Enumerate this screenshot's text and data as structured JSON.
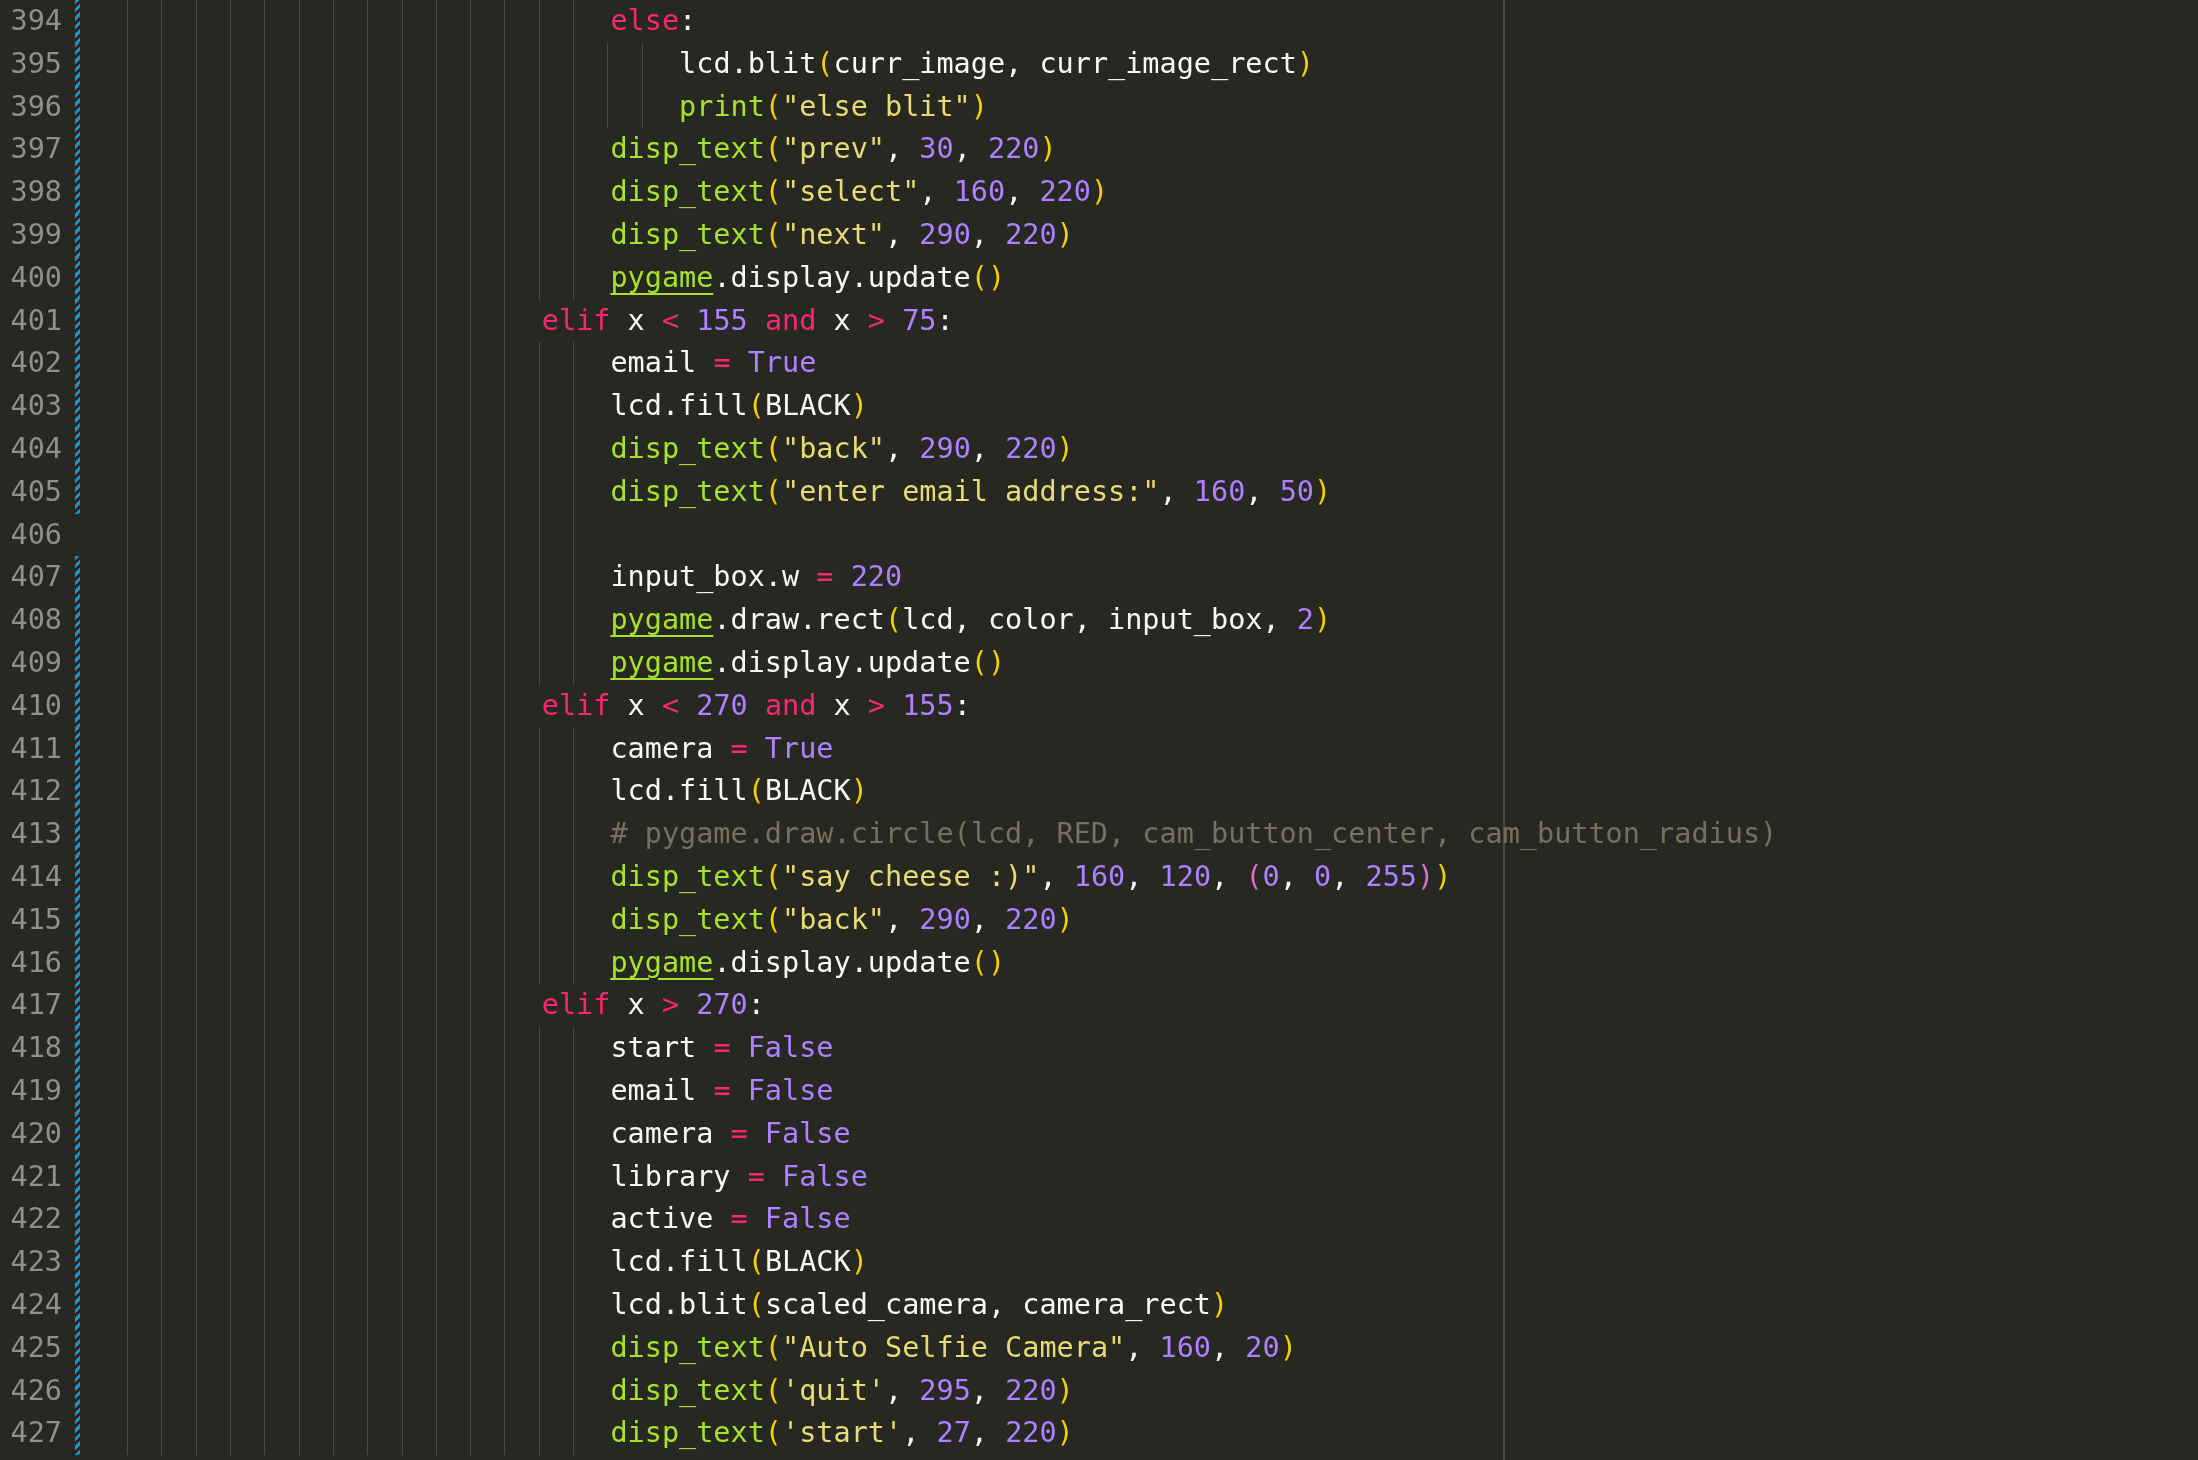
{
  "editor": {
    "lines": [
      {
        "number": "394",
        "changed": true,
        "kind": "statement",
        "tokens": [
          {
            "kind": "keyword",
            "text": "else"
          },
          {
            "kind": "plain",
            "text": ":"
          }
        ]
      },
      {
        "number": "395",
        "changed": true,
        "kind": "inner",
        "tokens": [
          {
            "kind": "plain",
            "text": "lcd.blit"
          },
          {
            "kind": "paren1",
            "text": "("
          },
          {
            "kind": "plain",
            "text": "curr_image, curr_image_rect"
          },
          {
            "kind": "paren1",
            "text": ")"
          }
        ]
      },
      {
        "number": "396",
        "changed": true,
        "kind": "inner",
        "tokens": [
          {
            "kind": "func",
            "text": "print"
          },
          {
            "kind": "paren1",
            "text": "("
          },
          {
            "kind": "string",
            "text": "\"else blit\""
          },
          {
            "kind": "paren1",
            "text": ")"
          }
        ]
      },
      {
        "number": "397",
        "changed": true,
        "kind": "statement",
        "tokens": [
          {
            "kind": "func",
            "text": "disp_text"
          },
          {
            "kind": "paren1",
            "text": "("
          },
          {
            "kind": "string",
            "text": "\"prev\""
          },
          {
            "kind": "plain",
            "text": ","
          },
          {
            "kind": "number",
            "text": " 30"
          },
          {
            "kind": "plain",
            "text": ","
          },
          {
            "kind": "number",
            "text": " 220"
          },
          {
            "kind": "paren1",
            "text": ")"
          }
        ]
      },
      {
        "number": "398",
        "changed": true,
        "kind": "statement",
        "tokens": [
          {
            "kind": "func",
            "text": "disp_text"
          },
          {
            "kind": "paren1",
            "text": "("
          },
          {
            "kind": "string",
            "text": "\"select\""
          },
          {
            "kind": "plain",
            "text": ","
          },
          {
            "kind": "number",
            "text": " 160"
          },
          {
            "kind": "plain",
            "text": ","
          },
          {
            "kind": "number",
            "text": " 220"
          },
          {
            "kind": "paren1",
            "text": ")"
          }
        ]
      },
      {
        "number": "399",
        "changed": true,
        "kind": "statement",
        "tokens": [
          {
            "kind": "func",
            "text": "disp_text"
          },
          {
            "kind": "paren1",
            "text": "("
          },
          {
            "kind": "string",
            "text": "\"next\""
          },
          {
            "kind": "plain",
            "text": ","
          },
          {
            "kind": "number",
            "text": " 290"
          },
          {
            "kind": "plain",
            "text": ","
          },
          {
            "kind": "number",
            "text": " 220"
          },
          {
            "kind": "paren1",
            "text": ")"
          }
        ]
      },
      {
        "number": "400",
        "changed": true,
        "kind": "statement",
        "tokens": [
          {
            "kind": "module",
            "text": "pygame"
          },
          {
            "kind": "plain",
            "text": ".display.update"
          },
          {
            "kind": "paren1",
            "text": "()"
          }
        ]
      },
      {
        "number": "401",
        "changed": true,
        "kind": "header",
        "tokens": [
          {
            "kind": "keyword",
            "text": "elif"
          },
          {
            "kind": "plain",
            "text": " x"
          },
          {
            "kind": "keyword",
            "text": " <"
          },
          {
            "kind": "number",
            "text": " 155"
          },
          {
            "kind": "keyword",
            "text": " and"
          },
          {
            "kind": "plain",
            "text": " x"
          },
          {
            "kind": "keyword",
            "text": " >"
          },
          {
            "kind": "number",
            "text": " 75"
          },
          {
            "kind": "plain",
            "text": ":"
          }
        ]
      },
      {
        "number": "402",
        "changed": true,
        "kind": "statement",
        "tokens": [
          {
            "kind": "plain",
            "text": "email"
          },
          {
            "kind": "keyword",
            "text": " ="
          },
          {
            "kind": "number",
            "text": " True"
          }
        ]
      },
      {
        "number": "403",
        "changed": true,
        "kind": "statement",
        "tokens": [
          {
            "kind": "plain",
            "text": "lcd.fill"
          },
          {
            "kind": "paren1",
            "text": "("
          },
          {
            "kind": "plain",
            "text": "BLACK"
          },
          {
            "kind": "paren1",
            "text": ")"
          }
        ]
      },
      {
        "number": "404",
        "changed": true,
        "kind": "statement",
        "tokens": [
          {
            "kind": "func",
            "text": "disp_text"
          },
          {
            "kind": "paren1",
            "text": "("
          },
          {
            "kind": "string",
            "text": "\"back\""
          },
          {
            "kind": "plain",
            "text": ","
          },
          {
            "kind": "number",
            "text": " 290"
          },
          {
            "kind": "plain",
            "text": ","
          },
          {
            "kind": "number",
            "text": " 220"
          },
          {
            "kind": "paren1",
            "text": ")"
          }
        ]
      },
      {
        "number": "405",
        "changed": true,
        "kind": "statement",
        "tokens": [
          {
            "kind": "func",
            "text": "disp_text"
          },
          {
            "kind": "paren1",
            "text": "("
          },
          {
            "kind": "string",
            "text": "\"enter email address:\""
          },
          {
            "kind": "plain",
            "text": ","
          },
          {
            "kind": "number",
            "text": " 160"
          },
          {
            "kind": "plain",
            "text": ","
          },
          {
            "kind": "number",
            "text": " 50"
          },
          {
            "kind": "paren1",
            "text": ")"
          }
        ]
      },
      {
        "number": "406",
        "changed": false,
        "kind": "blank"
      },
      {
        "number": "407",
        "changed": true,
        "kind": "statement",
        "tokens": [
          {
            "kind": "plain",
            "text": "input_box.w"
          },
          {
            "kind": "keyword",
            "text": " ="
          },
          {
            "kind": "number",
            "text": " 220"
          }
        ]
      },
      {
        "number": "408",
        "changed": true,
        "kind": "statement",
        "tokens": [
          {
            "kind": "module",
            "text": "pygame"
          },
          {
            "kind": "plain",
            "text": ".draw.rect"
          },
          {
            "kind": "paren1",
            "text": "("
          },
          {
            "kind": "plain",
            "text": "lcd, color, input_box,"
          },
          {
            "kind": "number",
            "text": " 2"
          },
          {
            "kind": "paren1",
            "text": ")"
          }
        ]
      },
      {
        "number": "409",
        "changed": true,
        "kind": "statement",
        "tokens": [
          {
            "kind": "module",
            "text": "pygame"
          },
          {
            "kind": "plain",
            "text": ".display.update"
          },
          {
            "kind": "paren1",
            "text": "()"
          }
        ]
      },
      {
        "number": "410",
        "changed": true,
        "kind": "header",
        "tokens": [
          {
            "kind": "keyword",
            "text": "elif"
          },
          {
            "kind": "plain",
            "text": " x"
          },
          {
            "kind": "keyword",
            "text": " <"
          },
          {
            "kind": "number",
            "text": " 270"
          },
          {
            "kind": "keyword",
            "text": " and"
          },
          {
            "kind": "plain",
            "text": " x"
          },
          {
            "kind": "keyword",
            "text": " >"
          },
          {
            "kind": "number",
            "text": " 155"
          },
          {
            "kind": "plain",
            "text": ":"
          }
        ]
      },
      {
        "number": "411",
        "changed": true,
        "kind": "statement",
        "tokens": [
          {
            "kind": "plain",
            "text": "camera"
          },
          {
            "kind": "keyword",
            "text": " ="
          },
          {
            "kind": "number",
            "text": " True"
          }
        ]
      },
      {
        "number": "412",
        "changed": true,
        "kind": "statement",
        "tokens": [
          {
            "kind": "plain",
            "text": "lcd.fill"
          },
          {
            "kind": "paren1",
            "text": "("
          },
          {
            "kind": "plain",
            "text": "BLACK"
          },
          {
            "kind": "paren1",
            "text": ")"
          }
        ]
      },
      {
        "number": "413",
        "changed": true,
        "kind": "statement",
        "tokens": [
          {
            "kind": "comment",
            "text": "# pygame.draw.circle(lcd, RED, cam_button_center, cam_button_radius)"
          }
        ]
      },
      {
        "number": "414",
        "changed": true,
        "kind": "statement",
        "tokens": [
          {
            "kind": "func",
            "text": "disp_text"
          },
          {
            "kind": "paren1",
            "text": "("
          },
          {
            "kind": "string",
            "text": "\"say cheese :)\""
          },
          {
            "kind": "plain",
            "text": ","
          },
          {
            "kind": "number",
            "text": " 160"
          },
          {
            "kind": "plain",
            "text": ","
          },
          {
            "kind": "number",
            "text": " 120"
          },
          {
            "kind": "plain",
            "text": ","
          },
          {
            "kind": "paren2",
            "text": " ("
          },
          {
            "kind": "number",
            "text": "0"
          },
          {
            "kind": "plain",
            "text": ","
          },
          {
            "kind": "number",
            "text": " 0"
          },
          {
            "kind": "plain",
            "text": ","
          },
          {
            "kind": "number",
            "text": " 255"
          },
          {
            "kind": "paren2",
            "text": ")"
          },
          {
            "kind": "paren1",
            "text": ")"
          }
        ]
      },
      {
        "number": "415",
        "changed": true,
        "kind": "statement",
        "tokens": [
          {
            "kind": "func",
            "text": "disp_text"
          },
          {
            "kind": "paren1",
            "text": "("
          },
          {
            "kind": "string",
            "text": "\"back\""
          },
          {
            "kind": "plain",
            "text": ","
          },
          {
            "kind": "number",
            "text": " 290"
          },
          {
            "kind": "plain",
            "text": ","
          },
          {
            "kind": "number",
            "text": " 220"
          },
          {
            "kind": "paren1",
            "text": ")"
          }
        ]
      },
      {
        "number": "416",
        "changed": true,
        "kind": "statement",
        "tokens": [
          {
            "kind": "module",
            "text": "pygame"
          },
          {
            "kind": "plain",
            "text": ".display.update"
          },
          {
            "kind": "paren1",
            "text": "()"
          }
        ]
      },
      {
        "number": "417",
        "changed": true,
        "kind": "header",
        "tokens": [
          {
            "kind": "keyword",
            "text": "elif"
          },
          {
            "kind": "plain",
            "text": " x"
          },
          {
            "kind": "keyword",
            "text": " >"
          },
          {
            "kind": "number",
            "text": " 270"
          },
          {
            "kind": "plain",
            "text": ":"
          }
        ]
      },
      {
        "number": "418",
        "changed": true,
        "kind": "statement",
        "tokens": [
          {
            "kind": "plain",
            "text": "start"
          },
          {
            "kind": "keyword",
            "text": " ="
          },
          {
            "kind": "number",
            "text": " False"
          }
        ]
      },
      {
        "number": "419",
        "changed": true,
        "kind": "statement",
        "tokens": [
          {
            "kind": "plain",
            "text": "email"
          },
          {
            "kind": "keyword",
            "text": " ="
          },
          {
            "kind": "number",
            "text": " False"
          }
        ]
      },
      {
        "number": "420",
        "changed": true,
        "kind": "statement",
        "tokens": [
          {
            "kind": "plain",
            "text": "camera"
          },
          {
            "kind": "keyword",
            "text": " ="
          },
          {
            "kind": "number",
            "text": " False"
          }
        ]
      },
      {
        "number": "421",
        "changed": true,
        "kind": "statement",
        "tokens": [
          {
            "kind": "plain",
            "text": "library"
          },
          {
            "kind": "keyword",
            "text": " ="
          },
          {
            "kind": "number",
            "text": " False"
          }
        ]
      },
      {
        "number": "422",
        "changed": true,
        "kind": "statement",
        "tokens": [
          {
            "kind": "plain",
            "text": "active"
          },
          {
            "kind": "keyword",
            "text": " ="
          },
          {
            "kind": "number",
            "text": " False"
          }
        ]
      },
      {
        "number": "423",
        "changed": true,
        "kind": "statement",
        "tokens": [
          {
            "kind": "plain",
            "text": "lcd.fill"
          },
          {
            "kind": "paren1",
            "text": "("
          },
          {
            "kind": "plain",
            "text": "BLACK"
          },
          {
            "kind": "paren1",
            "text": ")"
          }
        ]
      },
      {
        "number": "424",
        "changed": true,
        "kind": "statement",
        "tokens": [
          {
            "kind": "plain",
            "text": "lcd.blit"
          },
          {
            "kind": "paren1",
            "text": "("
          },
          {
            "kind": "plain",
            "text": "scaled_camera, camera_rect"
          },
          {
            "kind": "paren1",
            "text": ")"
          }
        ]
      },
      {
        "number": "425",
        "changed": true,
        "kind": "statement",
        "tokens": [
          {
            "kind": "func",
            "text": "disp_text"
          },
          {
            "kind": "paren1",
            "text": "("
          },
          {
            "kind": "string",
            "text": "\"Auto Selfie Camera\""
          },
          {
            "kind": "plain",
            "text": ","
          },
          {
            "kind": "number",
            "text": " 160"
          },
          {
            "kind": "plain",
            "text": ","
          },
          {
            "kind": "number",
            "text": " 20"
          },
          {
            "kind": "paren1",
            "text": ")"
          }
        ]
      },
      {
        "number": "426",
        "changed": true,
        "kind": "statement",
        "tokens": [
          {
            "kind": "func",
            "text": "disp_text"
          },
          {
            "kind": "paren1",
            "text": "("
          },
          {
            "kind": "string",
            "text": "'quit'"
          },
          {
            "kind": "plain",
            "text": ","
          },
          {
            "kind": "number",
            "text": " 295"
          },
          {
            "kind": "plain",
            "text": ","
          },
          {
            "kind": "number",
            "text": " 220"
          },
          {
            "kind": "paren1",
            "text": ")"
          }
        ]
      },
      {
        "number": "427",
        "changed": true,
        "kind": "statement",
        "tokens": [
          {
            "kind": "func",
            "text": "disp_text"
          },
          {
            "kind": "paren1",
            "text": "("
          },
          {
            "kind": "string",
            "text": "'start'"
          },
          {
            "kind": "plain",
            "text": ","
          },
          {
            "kind": "number",
            "text": " 27"
          },
          {
            "kind": "plain",
            "text": ","
          },
          {
            "kind": "number",
            "text": " 220"
          },
          {
            "kind": "paren1",
            "text": ")"
          }
        ]
      }
    ]
  }
}
